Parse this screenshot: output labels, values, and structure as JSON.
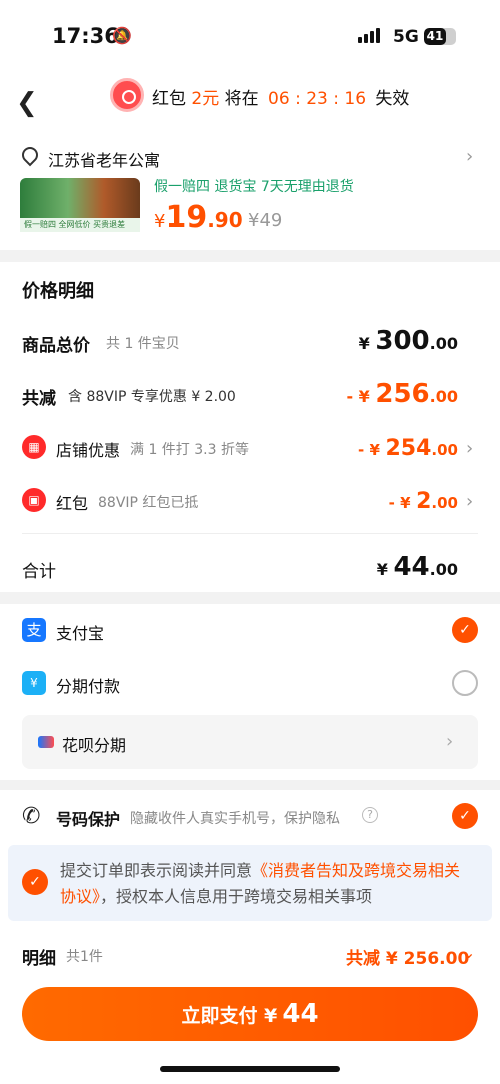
{
  "status_bar": {
    "time": "17:36",
    "network": "5G",
    "battery": "41"
  },
  "header": {
    "redpacket_prefix": "红包",
    "redpacket_amount": "2元",
    "expire_prefix": "将在",
    "countdown": "06 : 23 : 16",
    "expire_suffix": "失效"
  },
  "address": {
    "text": "江苏省老年公寓"
  },
  "product": {
    "tags": "假一赔四  退货宝  7天无理由退货",
    "price_symbol": "¥",
    "price_int": "19",
    "price_dec": ".90",
    "original_price": "¥49",
    "thumb_labels": [
      "假一赔四",
      "全网低价",
      "买贵退差"
    ]
  },
  "price_detail": {
    "title": "价格明细",
    "total_label": "商品总价",
    "total_sub": "共 1 件宝贝",
    "total_symbol": "¥",
    "total_int": "300",
    "total_dec": ".00",
    "discount_label": "共减",
    "discount_sub": "含 88VIP 专享优惠 ¥ 2.00",
    "discount_prefix": "- ¥",
    "discount_int": "256",
    "discount_dec": ".00",
    "shop_label": "店铺优惠",
    "shop_sub": "满 1 件打 3.3 折等",
    "shop_prefix": "- ¥",
    "shop_int": "254",
    "shop_dec": ".00",
    "redpacket_label": "红包",
    "redpacket_sub": "88VIP 红包已抵",
    "redpacket_prefix": "- ¥",
    "redpacket_int": "2",
    "redpacket_dec": ".00",
    "sum_label": "合计",
    "sum_symbol": "¥",
    "sum_int": "44",
    "sum_dec": ".00"
  },
  "payment": {
    "alipay_label": "支付宝",
    "installment_label": "分期付款",
    "huabei_label": "花呗分期",
    "alipay_selected": true,
    "installment_selected": false
  },
  "privacy": {
    "label": "号码保护",
    "desc": "隐藏收件人真实手机号，保护隐私"
  },
  "agreement": {
    "prefix": "提交订单即表示阅读并同意",
    "link": "《消费者告知及跨境交易相关协议》",
    "suffix": "，授权本人信息用于跨境交易相关事项"
  },
  "footer": {
    "detail_label": "明细",
    "detail_count": "共1件",
    "total_discount": "共减 ¥ 256.00",
    "pay_label": "立即支付 ¥",
    "pay_amount": "44"
  },
  "colors": {
    "accent": "#ff5000",
    "alipay": "#1677ff"
  }
}
